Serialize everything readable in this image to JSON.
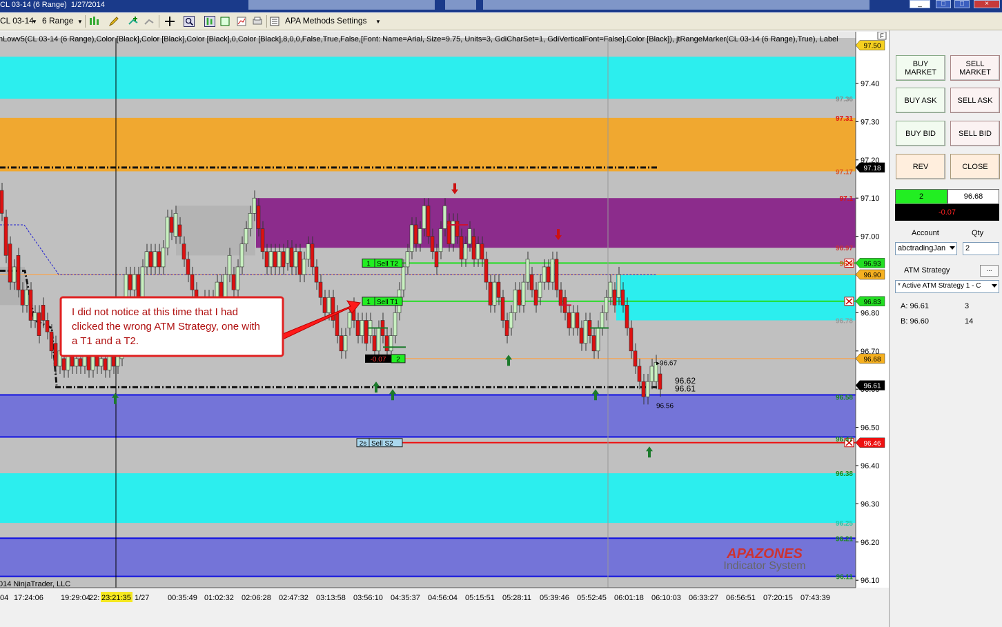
{
  "window": {
    "title": "CL 03-14 (6 Range)  1/27/2014",
    "controls": [
      "_",
      "□",
      "×"
    ]
  },
  "toolbar": {
    "instrument": "CL 03-14",
    "interval": "6 Range",
    "strategy_menu": "APA Methods Settings"
  },
  "chart": {
    "header_text": "nLowv5(CL 03-14 (6 Range),Color [Black],Color [Black],Color [Black],0,Color [Black],8,0,0,False,True,False,[Font: Name=Arial, Size=9.75, Units=3, GdiCharSet=1, GdiVerticalFont=False],Color [Black]), jtRangeMarker(CL 03-14 (6 Range),True), Label",
    "copyright": "014 NinjaTrader, LLC",
    "watermark_title": "APAZONES",
    "watermark_sub": "Indicator System",
    "y_ticks": [
      "97.40",
      "97.30",
      "97.20",
      "97.10",
      "97.00",
      "96.90",
      "96.80",
      "96.70",
      "96.60",
      "96.50",
      "96.40",
      "96.30",
      "96.20",
      "96.10"
    ],
    "x_ticks": [
      "04",
      "17:24:06",
      "19:29:04",
      "22:",
      "23:21:35",
      "1/27",
      "00:35:49",
      "01:02:32",
      "02:06:28",
      "02:47:32",
      "03:13:58",
      "03:56:10",
      "04:35:37",
      "04:56:04",
      "05:15:51",
      "05:28:11",
      "05:39:46",
      "05:52:45",
      "06:01:18",
      "06:10:03",
      "06:33:27",
      "06:56:51",
      "07:20:15",
      "07:43:39"
    ],
    "zone_labels": [
      "97.36",
      "97.31",
      "97.17",
      "97.1",
      "96.97",
      "96.78",
      "96.58",
      "96.47",
      "96.38",
      "96.25",
      "96.21",
      "96.11",
      "96.9"
    ],
    "right_markers": {
      "top": "97.50",
      "black1": "97.18",
      "green1": "96.93",
      "orange1": "96.90",
      "green2": "96.83",
      "orange2": "96.68",
      "last": "96.61",
      "red": "96.46"
    },
    "orders": {
      "sell_t2_qty": "1",
      "sell_t2_label": "Sell T2",
      "sell_t1_qty": "1",
      "sell_t1_label": "Sell T1",
      "pnl": "-0.07",
      "pos_qty": "2",
      "stop_qty": "2s",
      "stop_label": "Sell S2"
    },
    "price_notes": [
      "96.67",
      "96.62",
      "96.61",
      "96.56"
    ],
    "callout": "I did not notice at this time that I had clicked the wrong ATM Strategy, one with a T1 and a T2."
  },
  "panel": {
    "buttons": {
      "buy_market": "BUY MARKET",
      "sell_market": "SELL MARKET",
      "buy_ask": "BUY ASK",
      "sell_ask": "SELL ASK",
      "buy_bid": "BUY BID",
      "sell_bid": "SELL BID",
      "rev": "REV",
      "close": "CLOSE"
    },
    "position": {
      "qty": "2",
      "price": "96.68",
      "pnl": "-0.07"
    },
    "account_label": "Account",
    "qty_label": "Qty",
    "account_value": "abctradingJan",
    "qty_value": "2",
    "atm_label": "ATM Strategy",
    "atm_button": "...",
    "atm_value": "* Active ATM Strategy 1 - C",
    "levels": [
      {
        "name": "A: 96.61",
        "qty": "3"
      },
      {
        "name": "B: 96.60",
        "qty": "14"
      }
    ]
  },
  "colors": {
    "cyan": "#2ceeee",
    "orange": "#f0a830",
    "purple": "#8c2c8c",
    "blue_zone": "#7474d8",
    "bg": "#c0c0c0",
    "green_bar": "#22dd22",
    "red_marker": "#ff2020"
  }
}
